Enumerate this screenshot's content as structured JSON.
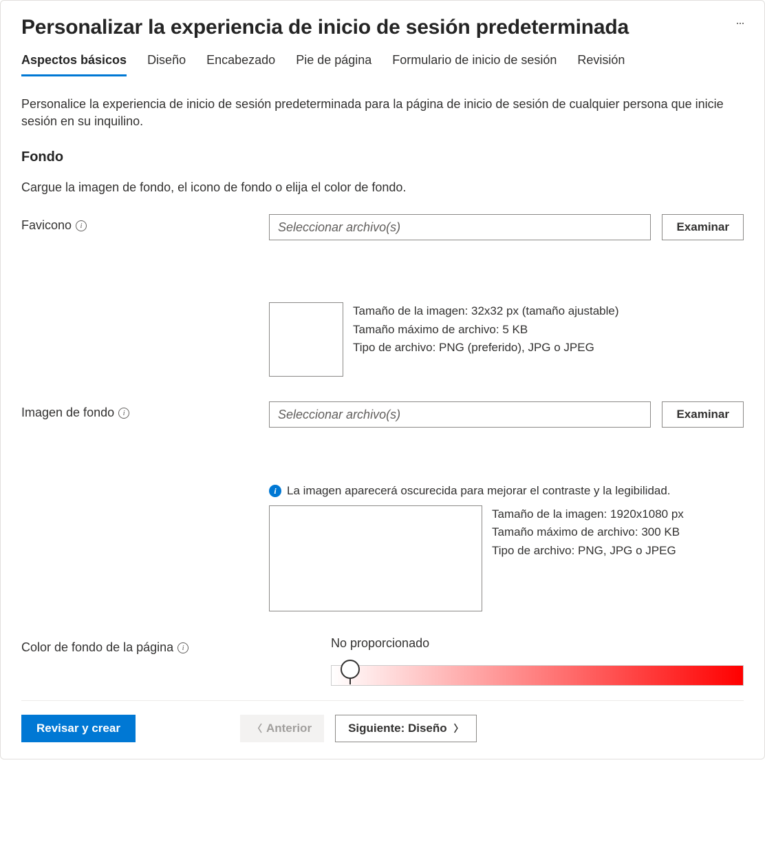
{
  "header": {
    "title": "Personalizar la experiencia de inicio de sesión predeterminada",
    "more_aria": "Más opciones"
  },
  "tabs": {
    "items": [
      {
        "label": "Aspectos básicos",
        "active": true
      },
      {
        "label": "Diseño",
        "active": false
      },
      {
        "label": "Encabezado",
        "active": false
      },
      {
        "label": "Pie de página",
        "active": false
      },
      {
        "label": "Formulario de inicio de sesión",
        "active": false
      },
      {
        "label": "Revisión",
        "active": false
      }
    ]
  },
  "intro": "Personalice la experiencia de inicio de sesión predeterminada para la página de inicio de sesión de cualquier persona que inicie sesión en su inquilino.",
  "section": {
    "heading": "Fondo",
    "subtext": "Cargue la imagen de fondo, el icono de fondo o elija el color de fondo."
  },
  "favicon": {
    "label": "Favicono",
    "placeholder": "Seleccionar archivo(s)",
    "browse": "Examinar",
    "spec_size": "Tamaño de la imagen: 32x32 px (tamaño ajustable)",
    "spec_max": "Tamaño máximo de archivo: 5 KB",
    "spec_type": "Tipo de archivo: PNG (preferido), JPG o JPEG"
  },
  "bgimage": {
    "label": "Imagen de fondo",
    "placeholder": "Seleccionar archivo(s)",
    "browse": "Examinar",
    "info": "La imagen aparecerá oscurecida para mejorar el contraste y la legibilidad.",
    "spec_size": "Tamaño de la imagen: 1920x1080 px",
    "spec_max": "Tamaño máximo de archivo: 300 KB",
    "spec_type": "Tipo de archivo: PNG, JPG o JPEG"
  },
  "bgcolor": {
    "label": "Color de fondo de la página",
    "value": "No proporcionado"
  },
  "footer": {
    "review": "Revisar y crear",
    "prev": "Anterior",
    "next": "Siguiente: Diseño"
  }
}
